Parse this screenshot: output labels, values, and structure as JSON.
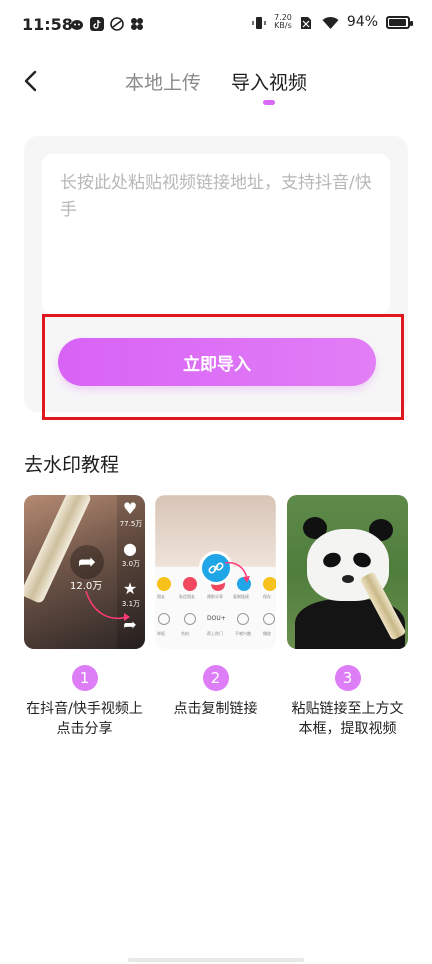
{
  "status_bar": {
    "time": "11:58",
    "net_speed_value": "7.20",
    "net_speed_unit": "KB/s",
    "battery_percent": "94%",
    "battery_level": 0.94,
    "left_icons": [
      "face-icon",
      "tiktok-icon",
      "fan-icon",
      "flower-icon"
    ],
    "right_icons": [
      "vibrate-icon",
      "no-sim-icon",
      "wifi-icon",
      "battery-icon"
    ]
  },
  "header": {
    "tabs": [
      {
        "label": "本地上传",
        "active": false
      },
      {
        "label": "导入视频",
        "active": true
      }
    ],
    "accent_color": "#d86af5"
  },
  "input": {
    "placeholder": "长按此处粘贴视频链接地址，支持抖音/快手",
    "value": ""
  },
  "import_button": {
    "label": "立即导入",
    "gradient": [
      "#d863f6",
      "#e27ef6"
    ],
    "highlight_color": "#e0171f"
  },
  "tutorial": {
    "title": "去水印教程",
    "steps": [
      {
        "number": "1",
        "text": "在抖音/快手视频上点击分享",
        "image_texts": {
          "likes": "77.5万",
          "comments": "3.0万",
          "favorites": "3.1万",
          "shares": "12.0万"
        }
      },
      {
        "number": "2",
        "text": "点击复制链接",
        "image_texts": {
          "labels": [
            "朋友",
            "私信朋友",
            "建群分享",
            "复制链接",
            "保存",
            "举报",
            "合拍",
            "DOU+",
            "帮上热门",
            "不感兴趣",
            "播放"
          ]
        }
      },
      {
        "number": "3",
        "text": "粘贴链接至上方文本框，提取视频"
      }
    ]
  }
}
